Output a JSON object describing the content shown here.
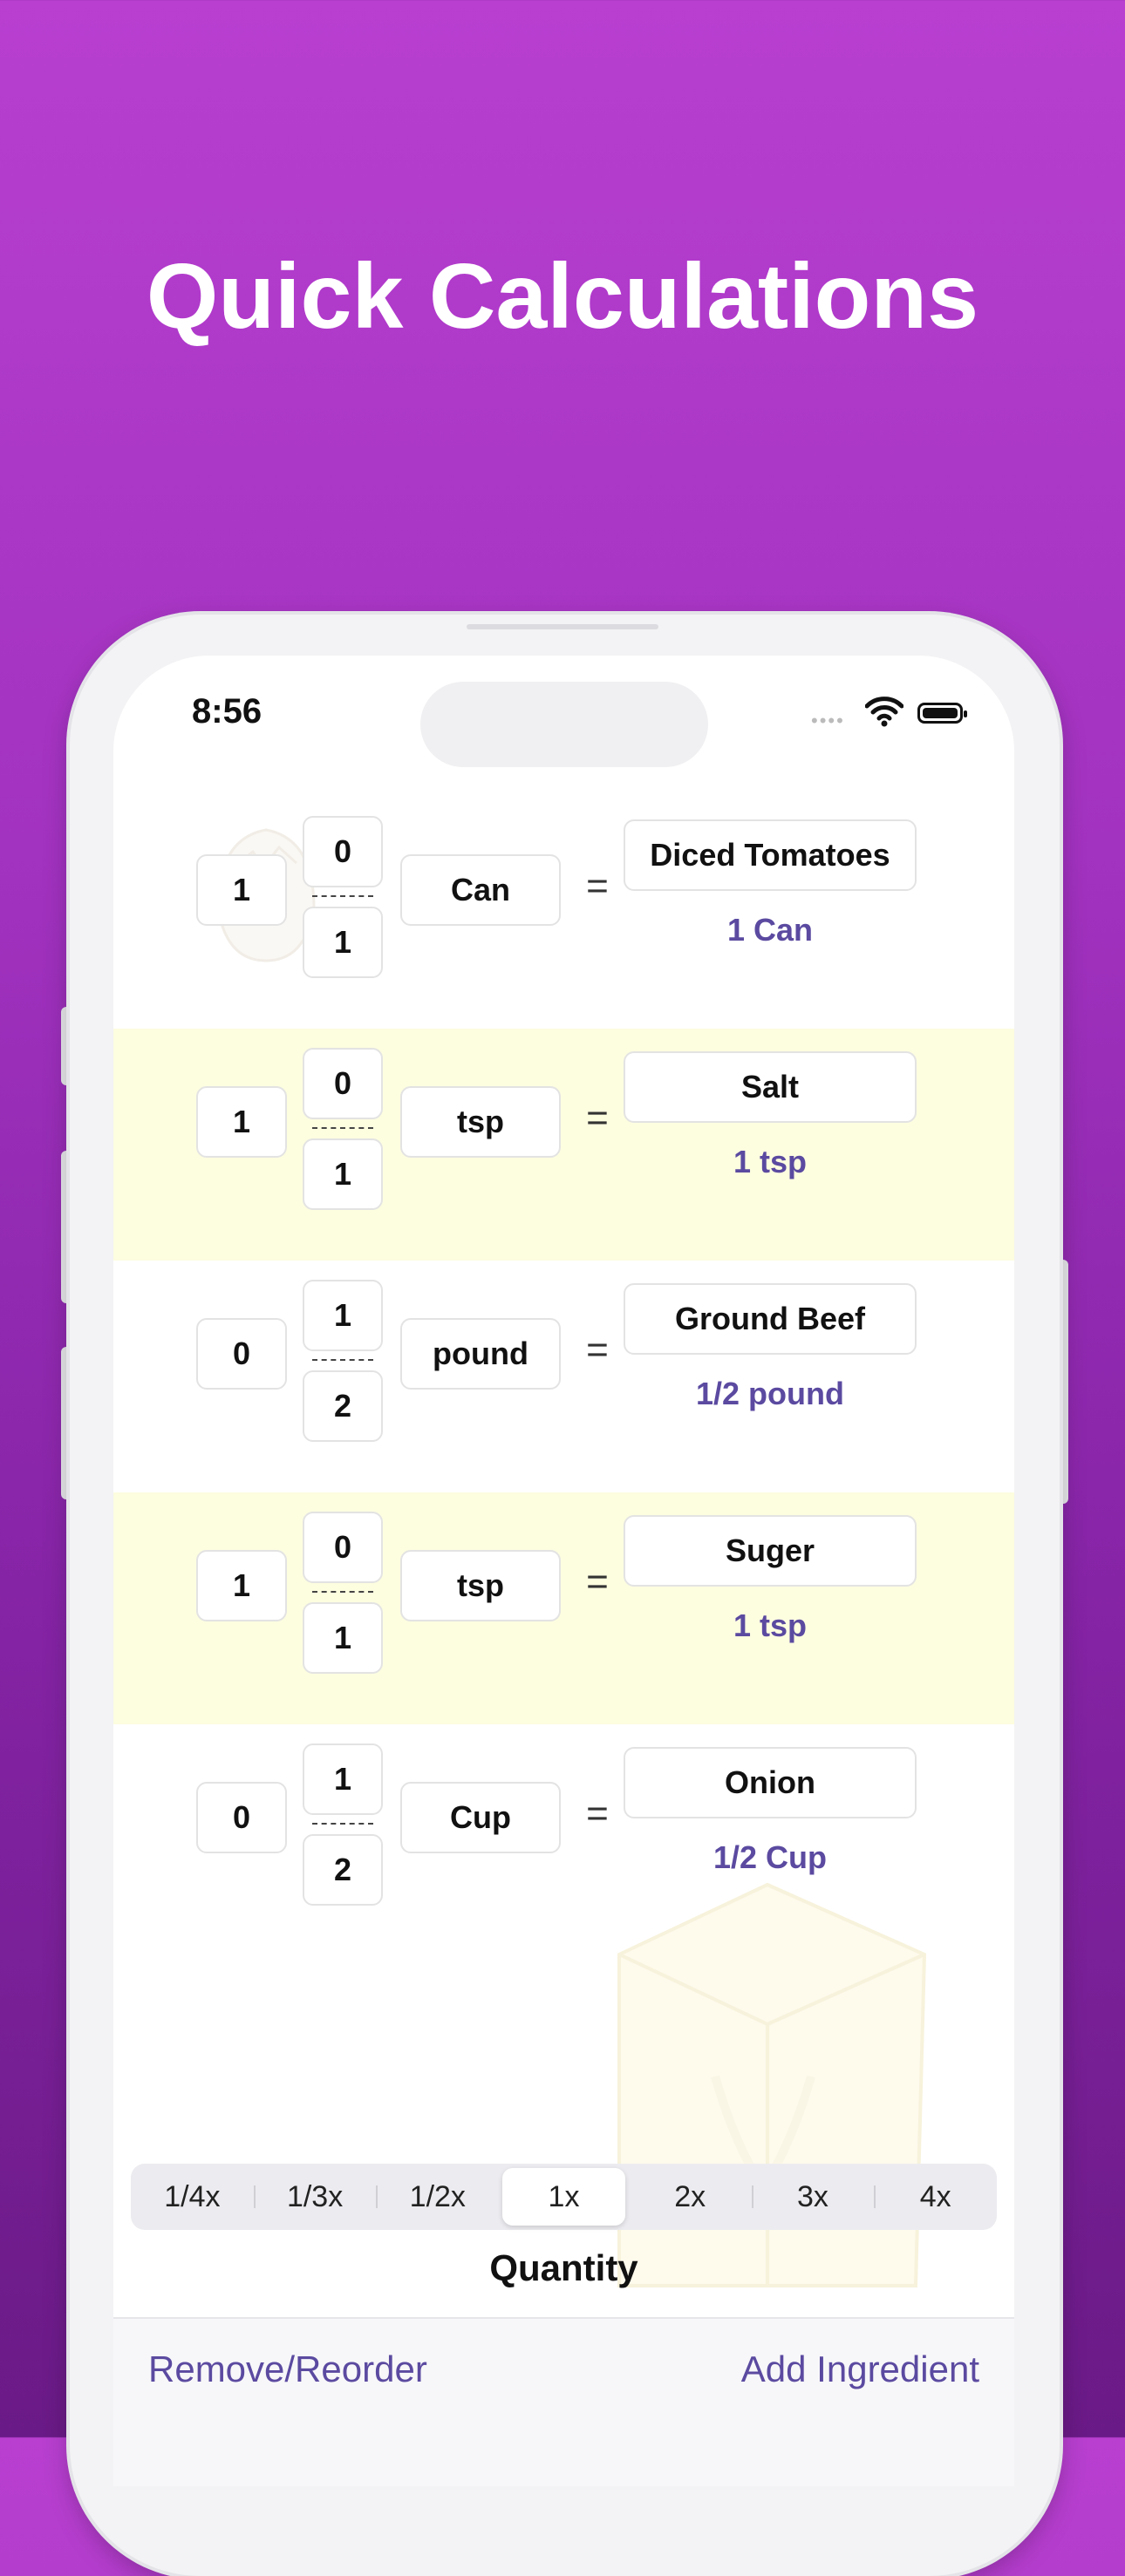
{
  "headline": "Quick Calculations",
  "status_bar": {
    "time": "8:56",
    "signal": "••••",
    "wifi_icon": "wifi-icon",
    "battery_icon": "battery-icon"
  },
  "ingredients": [
    {
      "whole": "1",
      "numerator": "0",
      "denominator": "1",
      "unit": "Can",
      "equals": "=",
      "name": "Diced Tomatoes",
      "result": "1 Can"
    },
    {
      "whole": "1",
      "numerator": "0",
      "denominator": "1",
      "unit": "tsp",
      "equals": "=",
      "name": "Salt",
      "result": "1 tsp"
    },
    {
      "whole": "0",
      "numerator": "1",
      "denominator": "2",
      "unit": "pound",
      "equals": "=",
      "name": "Ground Beef",
      "result": "1/2 pound"
    },
    {
      "whole": "1",
      "numerator": "0",
      "denominator": "1",
      "unit": "tsp",
      "equals": "=",
      "name": "Suger",
      "result": "1 tsp"
    },
    {
      "whole": "0",
      "numerator": "1",
      "denominator": "2",
      "unit": "Cup",
      "equals": "=",
      "name": "Onion",
      "result": "1/2 Cup"
    }
  ],
  "multiplier": {
    "options": [
      "1/4x",
      "1/3x",
      "1/2x",
      "1x",
      "2x",
      "3x",
      "4x"
    ],
    "selected": "1x",
    "label": "Quantity"
  },
  "toolbar": {
    "left_label": "Remove/Reorder",
    "right_label": "Add Ingredient"
  },
  "colors": {
    "background_top": "#b83fd0",
    "background_bottom": "#6a1a86",
    "accent": "#5b4aa0",
    "row_highlight": "#fdfde0"
  }
}
